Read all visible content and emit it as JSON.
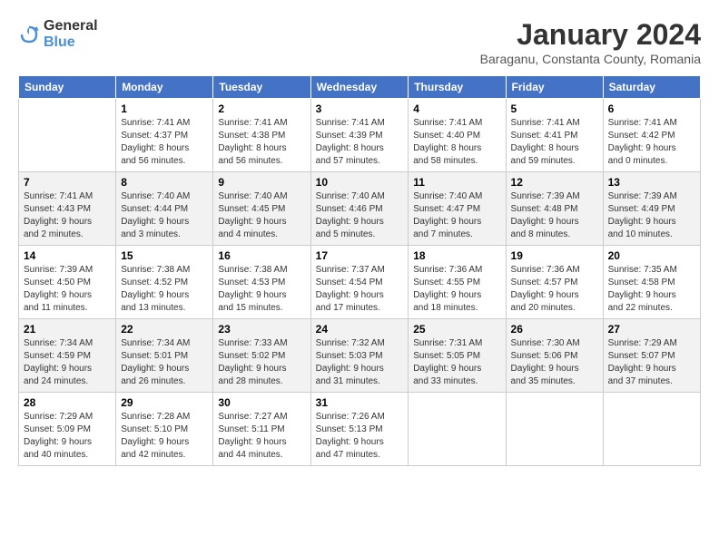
{
  "header": {
    "logo_general": "General",
    "logo_blue": "Blue",
    "month": "January 2024",
    "location": "Baraganu, Constanta County, Romania"
  },
  "weekdays": [
    "Sunday",
    "Monday",
    "Tuesday",
    "Wednesday",
    "Thursday",
    "Friday",
    "Saturday"
  ],
  "weeks": [
    [
      {
        "day": "",
        "info": ""
      },
      {
        "day": "1",
        "info": "Sunrise: 7:41 AM\nSunset: 4:37 PM\nDaylight: 8 hours\nand 56 minutes."
      },
      {
        "day": "2",
        "info": "Sunrise: 7:41 AM\nSunset: 4:38 PM\nDaylight: 8 hours\nand 56 minutes."
      },
      {
        "day": "3",
        "info": "Sunrise: 7:41 AM\nSunset: 4:39 PM\nDaylight: 8 hours\nand 57 minutes."
      },
      {
        "day": "4",
        "info": "Sunrise: 7:41 AM\nSunset: 4:40 PM\nDaylight: 8 hours\nand 58 minutes."
      },
      {
        "day": "5",
        "info": "Sunrise: 7:41 AM\nSunset: 4:41 PM\nDaylight: 8 hours\nand 59 minutes."
      },
      {
        "day": "6",
        "info": "Sunrise: 7:41 AM\nSunset: 4:42 PM\nDaylight: 9 hours\nand 0 minutes."
      }
    ],
    [
      {
        "day": "7",
        "info": "Sunrise: 7:41 AM\nSunset: 4:43 PM\nDaylight: 9 hours\nand 2 minutes."
      },
      {
        "day": "8",
        "info": "Sunrise: 7:40 AM\nSunset: 4:44 PM\nDaylight: 9 hours\nand 3 minutes."
      },
      {
        "day": "9",
        "info": "Sunrise: 7:40 AM\nSunset: 4:45 PM\nDaylight: 9 hours\nand 4 minutes."
      },
      {
        "day": "10",
        "info": "Sunrise: 7:40 AM\nSunset: 4:46 PM\nDaylight: 9 hours\nand 5 minutes."
      },
      {
        "day": "11",
        "info": "Sunrise: 7:40 AM\nSunset: 4:47 PM\nDaylight: 9 hours\nand 7 minutes."
      },
      {
        "day": "12",
        "info": "Sunrise: 7:39 AM\nSunset: 4:48 PM\nDaylight: 9 hours\nand 8 minutes."
      },
      {
        "day": "13",
        "info": "Sunrise: 7:39 AM\nSunset: 4:49 PM\nDaylight: 9 hours\nand 10 minutes."
      }
    ],
    [
      {
        "day": "14",
        "info": "Sunrise: 7:39 AM\nSunset: 4:50 PM\nDaylight: 9 hours\nand 11 minutes."
      },
      {
        "day": "15",
        "info": "Sunrise: 7:38 AM\nSunset: 4:52 PM\nDaylight: 9 hours\nand 13 minutes."
      },
      {
        "day": "16",
        "info": "Sunrise: 7:38 AM\nSunset: 4:53 PM\nDaylight: 9 hours\nand 15 minutes."
      },
      {
        "day": "17",
        "info": "Sunrise: 7:37 AM\nSunset: 4:54 PM\nDaylight: 9 hours\nand 17 minutes."
      },
      {
        "day": "18",
        "info": "Sunrise: 7:36 AM\nSunset: 4:55 PM\nDaylight: 9 hours\nand 18 minutes."
      },
      {
        "day": "19",
        "info": "Sunrise: 7:36 AM\nSunset: 4:57 PM\nDaylight: 9 hours\nand 20 minutes."
      },
      {
        "day": "20",
        "info": "Sunrise: 7:35 AM\nSunset: 4:58 PM\nDaylight: 9 hours\nand 22 minutes."
      }
    ],
    [
      {
        "day": "21",
        "info": "Sunrise: 7:34 AM\nSunset: 4:59 PM\nDaylight: 9 hours\nand 24 minutes."
      },
      {
        "day": "22",
        "info": "Sunrise: 7:34 AM\nSunset: 5:01 PM\nDaylight: 9 hours\nand 26 minutes."
      },
      {
        "day": "23",
        "info": "Sunrise: 7:33 AM\nSunset: 5:02 PM\nDaylight: 9 hours\nand 28 minutes."
      },
      {
        "day": "24",
        "info": "Sunrise: 7:32 AM\nSunset: 5:03 PM\nDaylight: 9 hours\nand 31 minutes."
      },
      {
        "day": "25",
        "info": "Sunrise: 7:31 AM\nSunset: 5:05 PM\nDaylight: 9 hours\nand 33 minutes."
      },
      {
        "day": "26",
        "info": "Sunrise: 7:30 AM\nSunset: 5:06 PM\nDaylight: 9 hours\nand 35 minutes."
      },
      {
        "day": "27",
        "info": "Sunrise: 7:29 AM\nSunset: 5:07 PM\nDaylight: 9 hours\nand 37 minutes."
      }
    ],
    [
      {
        "day": "28",
        "info": "Sunrise: 7:29 AM\nSunset: 5:09 PM\nDaylight: 9 hours\nand 40 minutes."
      },
      {
        "day": "29",
        "info": "Sunrise: 7:28 AM\nSunset: 5:10 PM\nDaylight: 9 hours\nand 42 minutes."
      },
      {
        "day": "30",
        "info": "Sunrise: 7:27 AM\nSunset: 5:11 PM\nDaylight: 9 hours\nand 44 minutes."
      },
      {
        "day": "31",
        "info": "Sunrise: 7:26 AM\nSunset: 5:13 PM\nDaylight: 9 hours\nand 47 minutes."
      },
      {
        "day": "",
        "info": ""
      },
      {
        "day": "",
        "info": ""
      },
      {
        "day": "",
        "info": ""
      }
    ]
  ]
}
